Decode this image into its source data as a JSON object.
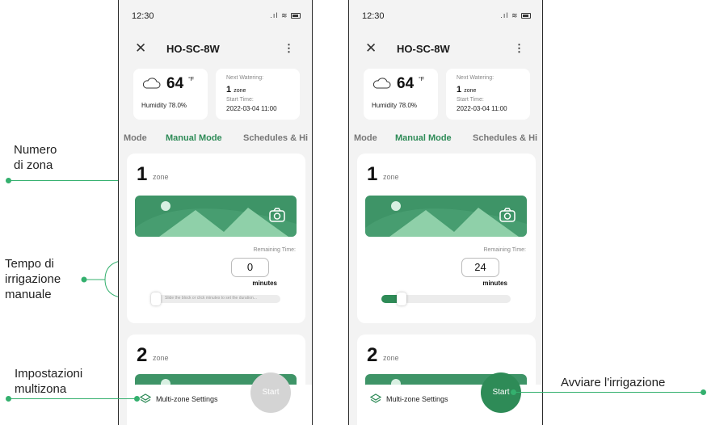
{
  "annotations": {
    "zone_number": [
      "Numero",
      "di zona"
    ],
    "manual_time": [
      "Tempo di",
      "irrigazione",
      "manuale"
    ],
    "multizone": [
      "Impostazioni",
      "multizona"
    ],
    "start_irrigation": "Avviare l'irrigazione"
  },
  "phones": [
    {
      "status_time": "12:30",
      "title": "HO-SC-8W",
      "temperature": "64",
      "temp_unit": "°F",
      "humidity": "Humidity 78.0%",
      "next_watering_label": "Next Watering:",
      "next_watering_count": "1",
      "next_watering_unit": "zone",
      "start_time_label": "Start Time:",
      "start_time": "2022-03-04 11:00",
      "tabs": [
        "Mode",
        "Manual Mode",
        "Schedules & Hi"
      ],
      "zones": [
        {
          "number": "1",
          "word": "zone",
          "remaining_label": "Remaining Time:",
          "remaining_value": "0",
          "minutes_label": "minutes",
          "slider_hint": "Slide the block or click minutes to set the duration...",
          "slider_fraction": 0.0
        },
        {
          "number": "2",
          "word": "zone"
        }
      ],
      "multizone_label": "Multi-zone Settings",
      "start_label": "Start"
    },
    {
      "status_time": "12:30",
      "title": "HO-SC-8W",
      "temperature": "64",
      "temp_unit": "°F",
      "humidity": "Humidity 78.0%",
      "next_watering_label": "Next Watering:",
      "next_watering_count": "1",
      "next_watering_unit": "zone",
      "start_time_label": "Start Time:",
      "start_time": "2022-03-04 11:00",
      "tabs": [
        "Mode",
        "Manual Mode",
        "Schedules & Hi"
      ],
      "zones": [
        {
          "number": "1",
          "word": "zone",
          "remaining_label": "Remaining Time:",
          "remaining_value": "24",
          "minutes_label": "minutes",
          "slider_hint": "",
          "slider_fraction": 0.12
        },
        {
          "number": "2",
          "word": "zone"
        }
      ],
      "multizone_label": "Multi-zone Settings",
      "start_label": "Start"
    }
  ],
  "colors": {
    "accent": "#2e8b57",
    "annotation_line": "#34b06e",
    "start_disabled": "#d4d4d4"
  }
}
